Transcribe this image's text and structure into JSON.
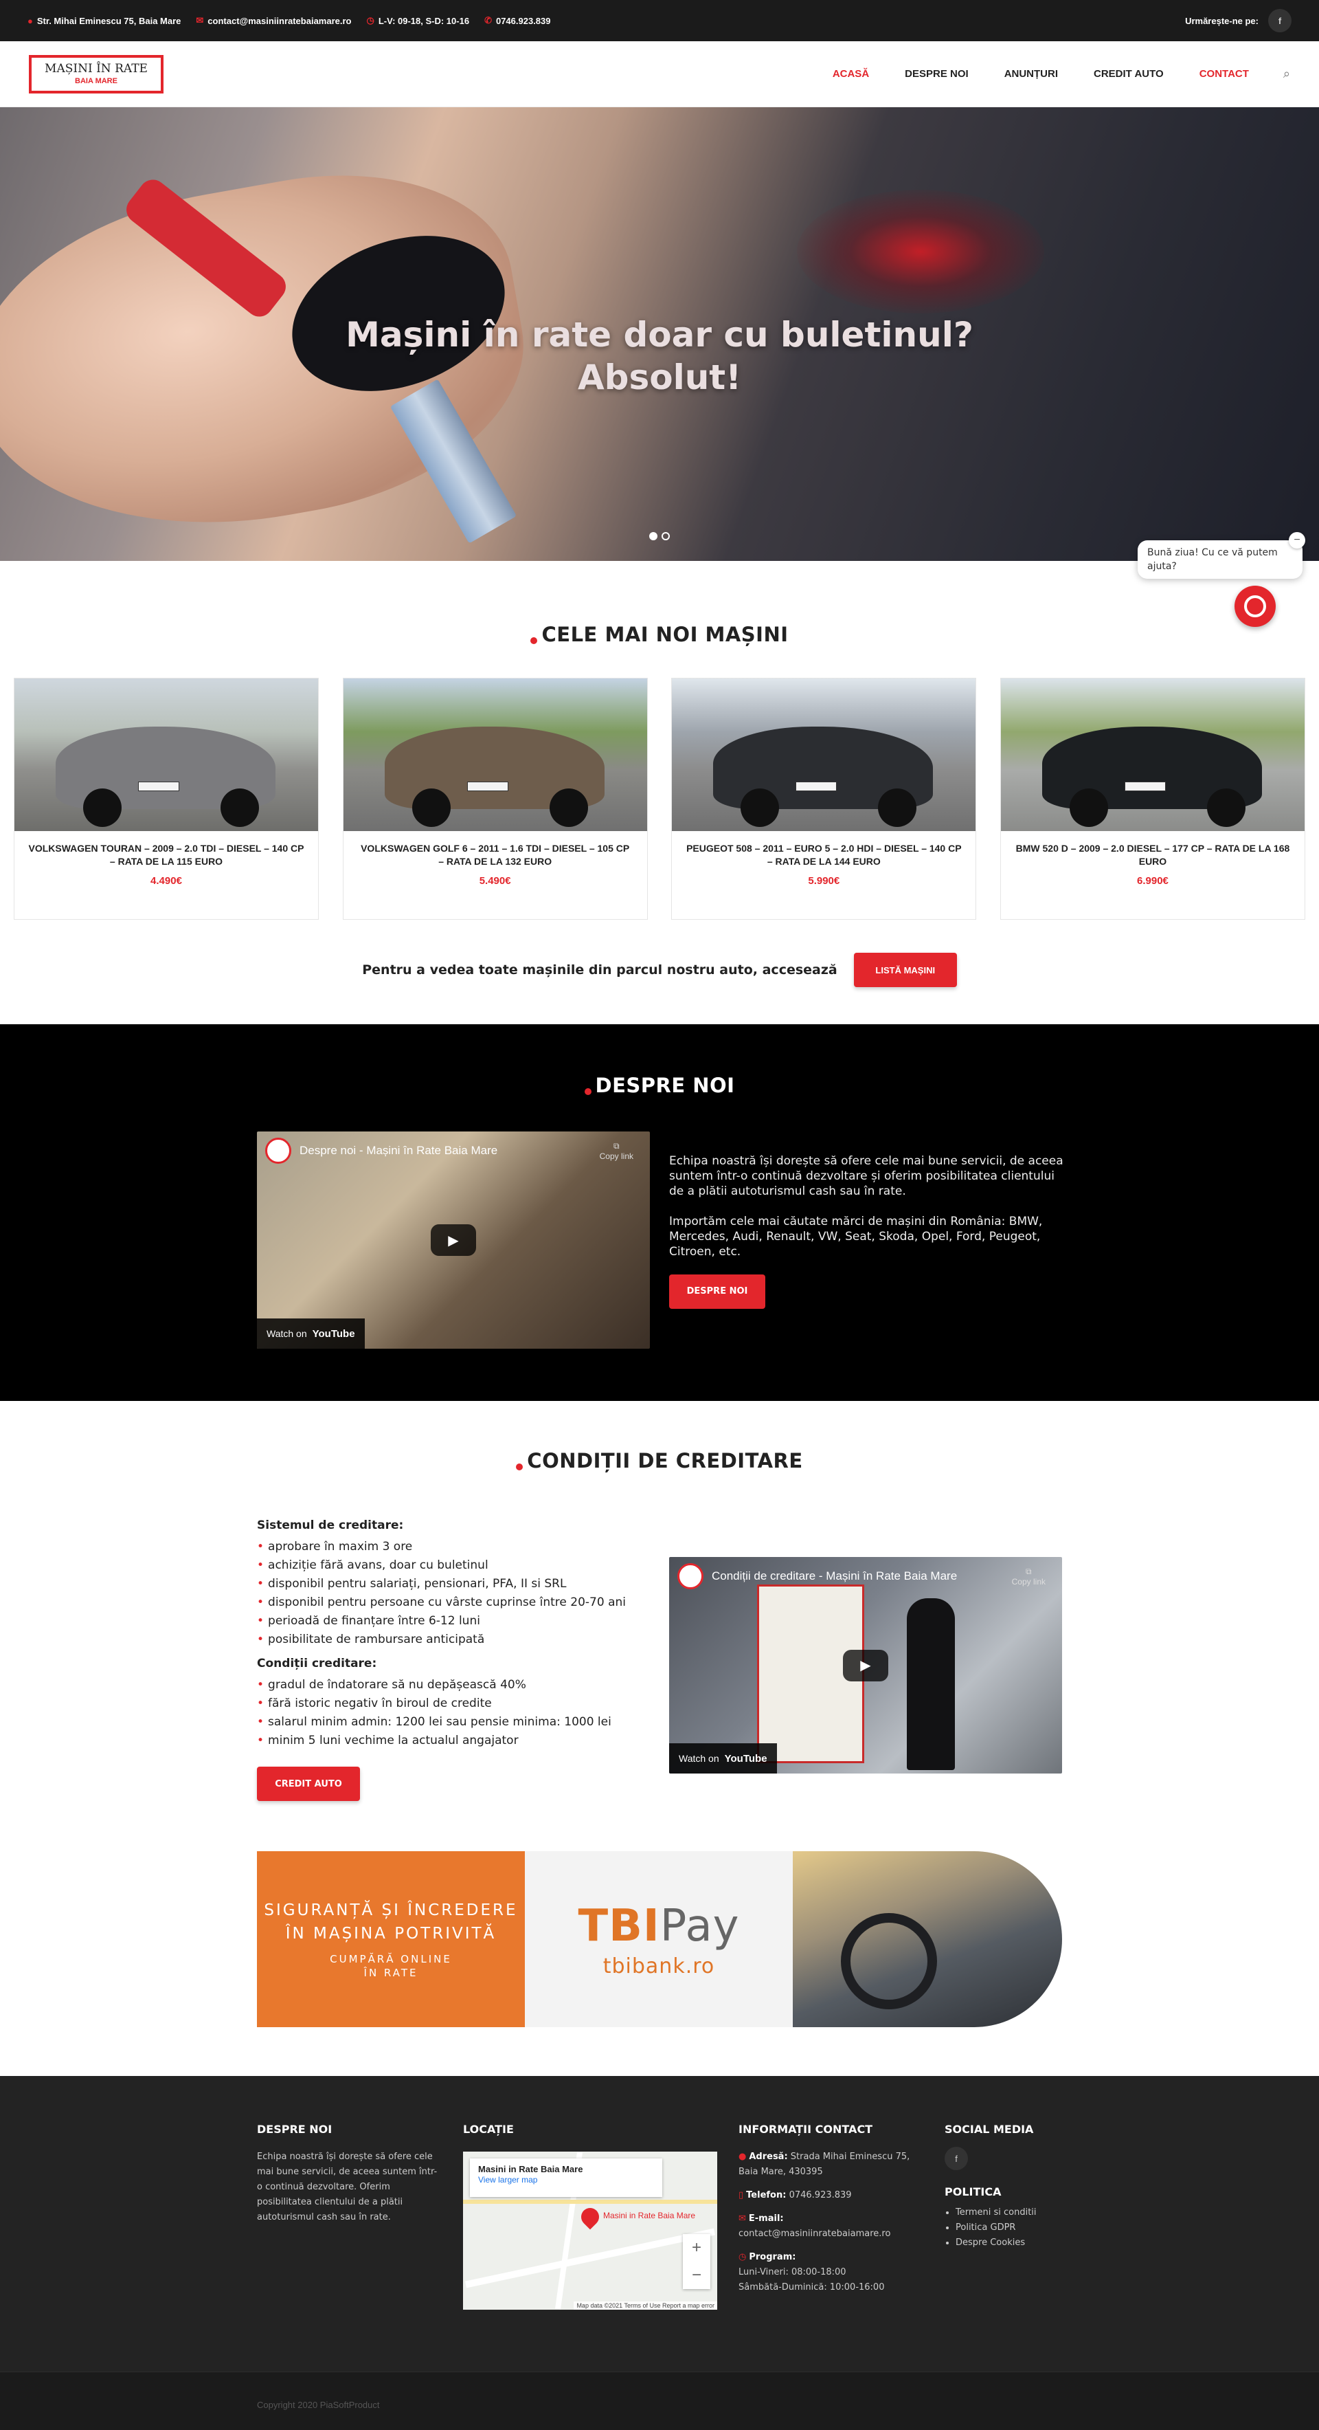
{
  "topbar": {
    "address": "Str. Mihai Eminescu 75, Baia Mare",
    "email": "contact@masiniinratebaiamare.ro",
    "hours": "L-V: 09-18, S-D: 10-16",
    "phone": "0746.923.839",
    "follow_label": "Urmărește-ne pe:",
    "facebook_icon": "f"
  },
  "header": {
    "logo_line1": "MAȘINI ÎN RATE",
    "logo_line2": "BAIA MARE",
    "nav": [
      {
        "label": "ACASĂ"
      },
      {
        "label": "DESPRE NOI"
      },
      {
        "label": "ANUNȚURI"
      },
      {
        "label": "CREDIT AUTO"
      },
      {
        "label": "CONTACT"
      }
    ]
  },
  "hero": {
    "title_line1": "Mașini în rate doar cu buletinul?",
    "title_line2": "Absolut!",
    "active_slide": 1,
    "slide_count": 2
  },
  "latest": {
    "title": "CELE MAI NOI MAȘINI",
    "cars": [
      {
        "title": "VOLKSWAGEN TOURAN – 2009 – 2.0 TDI – DIESEL – 140 CP – RATA DE LA 115 EURO",
        "price": "4.490€",
        "color": "#7b7b7e"
      },
      {
        "title": "VOLKSWAGEN GOLF 6 – 2011 – 1.6 TDI – DIESEL – 105 CP – RATA DE LA 132 EURO",
        "price": "5.490€",
        "color": "#6e5d4c"
      },
      {
        "title": "PEUGEOT 508 – 2011 – EURO 5 – 2.0 HDI – DIESEL – 140 CP – RATA DE LA 144 EURO",
        "price": "5.990€",
        "color": "#2b2d31"
      },
      {
        "title": "BMW 520 D – 2009 – 2.0 DIESEL – 177 CP – RATA DE LA 168 EURO",
        "price": "6.990€",
        "color": "#1c1f22"
      }
    ],
    "cta_text": "Pentru a vedea toate mașinile din parcul nostru auto, accesează",
    "cta_button": "LISTĂ MAȘINI"
  },
  "about": {
    "title": "DESPRE NOI",
    "video_title": "Despre noi - Mașini în Rate Baia Mare",
    "copy_link": "Copy link",
    "watch_on": "Watch on",
    "youtube": "YouTube",
    "paragraph1": "Echipa noastră își dorește să ofere cele mai bune servicii, de aceea suntem într-o continuă dezvoltare și oferim posibilitatea clientului de a plătii autoturismul cash sau în rate.",
    "paragraph2": "Importăm cele mai căutate mărci de mașini din România: BMW, Mercedes, Audi, Renault, VW, Seat, Skoda, Opel, Ford, Peugeot, Citroen, etc.",
    "button": "DESPRE NOI"
  },
  "credit": {
    "title": "CONDIȚII DE CREDITARE",
    "system_heading": "Sistemul de creditare:",
    "system_items": [
      "aprobare în maxim 3 ore",
      "achiziție fără avans, doar cu buletinul",
      "disponibil pentru salariați, pensionari, PFA, II si SRL",
      "disponibil pentru persoane cu vârste cuprinse între 20-70 ani",
      "perioadă de finanțare între 6-12 luni",
      "posibilitate de rambursare anticipată"
    ],
    "conditions_heading": "Condiții creditare:",
    "conditions_items": [
      "gradul de îndatorare să nu depășească 40%",
      "fără istoric negativ în biroul de credite",
      "salarul minim admin: 1200 lei sau pensie minima: 1000 lei",
      "minim 5 luni vechime la actualul angajator"
    ],
    "button": "CREDIT AUTO",
    "video_title": "Condiții de creditare - Mașini în Rate Baia Mare",
    "copy_link": "Copy link",
    "watch_on": "Watch on",
    "youtube": "YouTube"
  },
  "banner": {
    "line1": "SIGURANȚĂ ȘI ÎNCREDERE",
    "line2": "ÎN MAȘINA POTRIVITĂ",
    "line3": "CUMPĂRĂ ONLINE",
    "line4": "ÎN RATE",
    "brand_a": "TBI",
    "brand_b": "Pay",
    "url": "tbibank.ro"
  },
  "footer": {
    "about_title": "DESPRE NOI",
    "about_text": "Echipa noastră își dorește să ofere cele mai bune servicii, de aceea suntem într-o continuă dezvoltare. Oferim posibilitatea clientului de a plătii autoturismul cash sau în rate.",
    "location_title": "LOCAȚIE",
    "map_place": "Masini in Rate Baia Mare",
    "map_link": "View larger map",
    "map_attr": "Map data ©2021   Terms of Use   Report a map error",
    "contact_title": "INFORMAȚII CONTACT",
    "address_label": "Adresă:",
    "address": "Strada Mihai Eminescu 75, Baia Mare, 430395",
    "phone_label": "Telefon:",
    "phone": "0746.923.839",
    "email_label": "E-mail:",
    "email": "contact@masiniinratebaiamare.ro",
    "program_label": "Program:",
    "program1": "Luni-Vineri: 08:00-18:00",
    "program2": "Sâmbătă-Duminică: 10:00-16:00",
    "social_title": "SOCIAL MEDIA",
    "policy_title": "POLITICA",
    "policy_items": [
      "Termeni si conditii",
      "Politica GDPR",
      "Despre Cookies"
    ],
    "copyright": "Copyright 2020 PiaSoftProduct"
  },
  "chat": {
    "greeting": "Bună ziua! Cu ce vă putem ajuta?"
  }
}
